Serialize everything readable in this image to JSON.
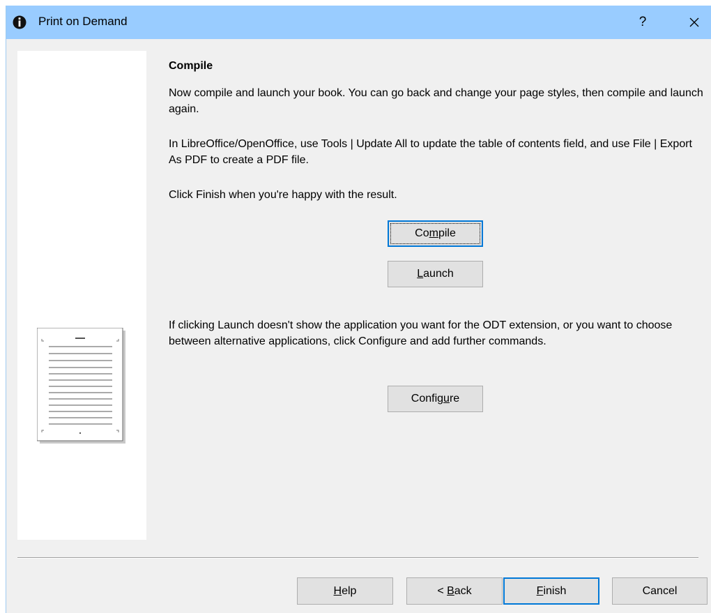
{
  "window": {
    "title": "Print on Demand"
  },
  "titlebar": {
    "app_icon": "info-icon",
    "help_label": "?",
    "close_icon": "close-icon"
  },
  "side_panel": {
    "illustration": "document-page-icon"
  },
  "content": {
    "heading": "Compile",
    "paragraph1": "Now compile and launch your book. You can go back and change your page styles, then compile and launch again.",
    "paragraph2": "In LibreOffice/OpenOffice, use Tools | Update All to update the table of contents field, and use File | Export As PDF to create a PDF file.",
    "paragraph3": "Click Finish when you're happy with the result.",
    "paragraph4": "If clicking Launch doesn't show the application you want for the ODT extension, or you want to choose between alternative applications, click Configure and add further commands."
  },
  "buttons": {
    "compile": {
      "before": "Co",
      "accel": "m",
      "after": "pile"
    },
    "launch": {
      "before": "",
      "accel": "L",
      "after": "aunch"
    },
    "configure": {
      "before": "Config",
      "accel": "u",
      "after": "re"
    }
  },
  "footer": {
    "help": {
      "before": "",
      "accel": "H",
      "after": "elp"
    },
    "back": {
      "before": "< ",
      "accel": "B",
      "after": "ack"
    },
    "finish": {
      "before": "",
      "accel": "F",
      "after": "inish"
    },
    "cancel": {
      "before": "Cancel",
      "accel": "",
      "after": ""
    }
  },
  "colors": {
    "titlebar": "#99ccff",
    "dialog_bg": "#f0f0f0",
    "button_bg": "#e1e1e1",
    "default_button_border": "#0078d7"
  }
}
